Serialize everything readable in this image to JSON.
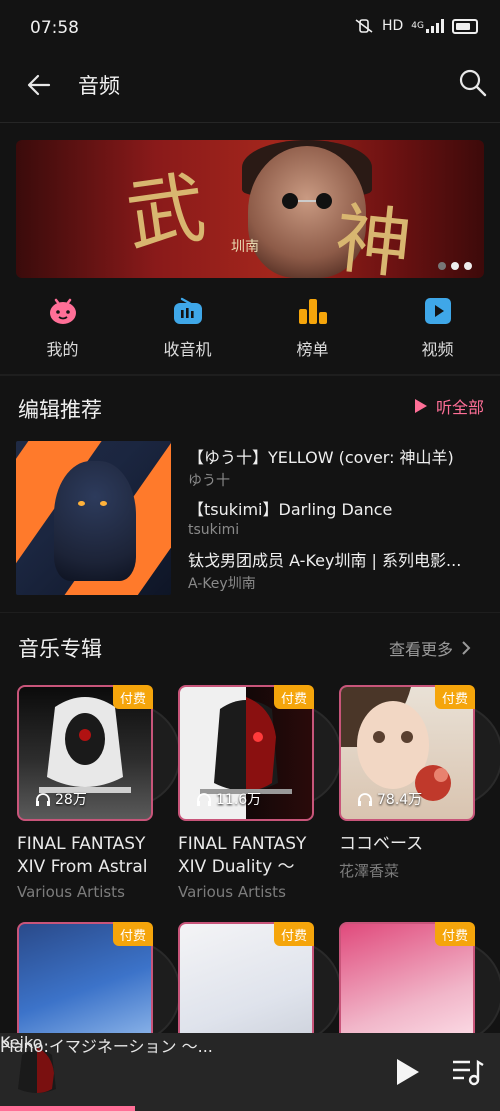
{
  "status_bar": {
    "time": "07:58",
    "network": "HD",
    "signal": "4G"
  },
  "header": {
    "title": "音频"
  },
  "banner": {
    "glyph_left": "武",
    "glyph_right": "神",
    "caption": "圳南"
  },
  "nav": [
    {
      "label": "我的",
      "icon": "my-icon",
      "color": "#ff6f97"
    },
    {
      "label": "收音机",
      "icon": "radio-icon",
      "color": "#3fa7e8"
    },
    {
      "label": "榜单",
      "icon": "chart-icon",
      "color": "#f5a50b"
    },
    {
      "label": "视频",
      "icon": "video-icon",
      "color": "#3fa7e8"
    }
  ],
  "editor": {
    "title": "编辑推荐",
    "more": "听全部",
    "items": [
      {
        "title": "【ゆう十】YELLOW (cover: 神山羊)",
        "artist": "ゆう十"
      },
      {
        "title": "【tsukimi】Darling Dance",
        "artist": "tsukimi"
      },
      {
        "title": "钛戈男团成员 A-Key圳南 | 系列电影...",
        "artist": "A-Key圳南"
      }
    ]
  },
  "albums": {
    "title": "音乐专辑",
    "more": "查看更多",
    "badge": "付费",
    "items": [
      {
        "name": "FINAL FANTASY XIV From Astral ...",
        "artist": "Various Artists",
        "plays": "28万"
      },
      {
        "name": "FINAL FANTASY XIV Duality ～ Ar...",
        "artist": "Various Artists",
        "plays": "11.6万"
      },
      {
        "name": "ココベース",
        "artist": "花澤香菜",
        "plays": "78.4万"
      }
    ]
  },
  "player": {
    "track": "Piano:イマジネーション ～...",
    "artist": "Keiko",
    "progress": 0.27
  },
  "colors": {
    "accent": "#ff6f97",
    "badge": "#f5a50b",
    "background": "#131313"
  }
}
